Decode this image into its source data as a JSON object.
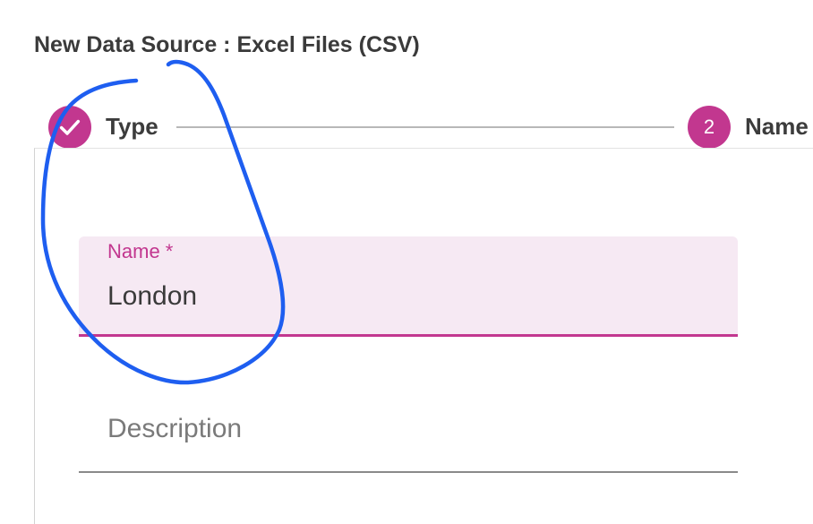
{
  "page": {
    "title": "New Data Source : Excel Files (CSV)"
  },
  "stepper": {
    "steps": [
      {
        "label": "Type",
        "status": "completed",
        "icon": "check-icon"
      },
      {
        "label": "Name",
        "status": "active",
        "number": "2"
      }
    ]
  },
  "form": {
    "name_field": {
      "label": "Name *",
      "value": "London"
    },
    "description_field": {
      "placeholder": "Description"
    }
  },
  "colors": {
    "accent": "#c2378f",
    "field_fill": "#f6e9f3",
    "annotation_stroke": "#1e5ef0"
  }
}
